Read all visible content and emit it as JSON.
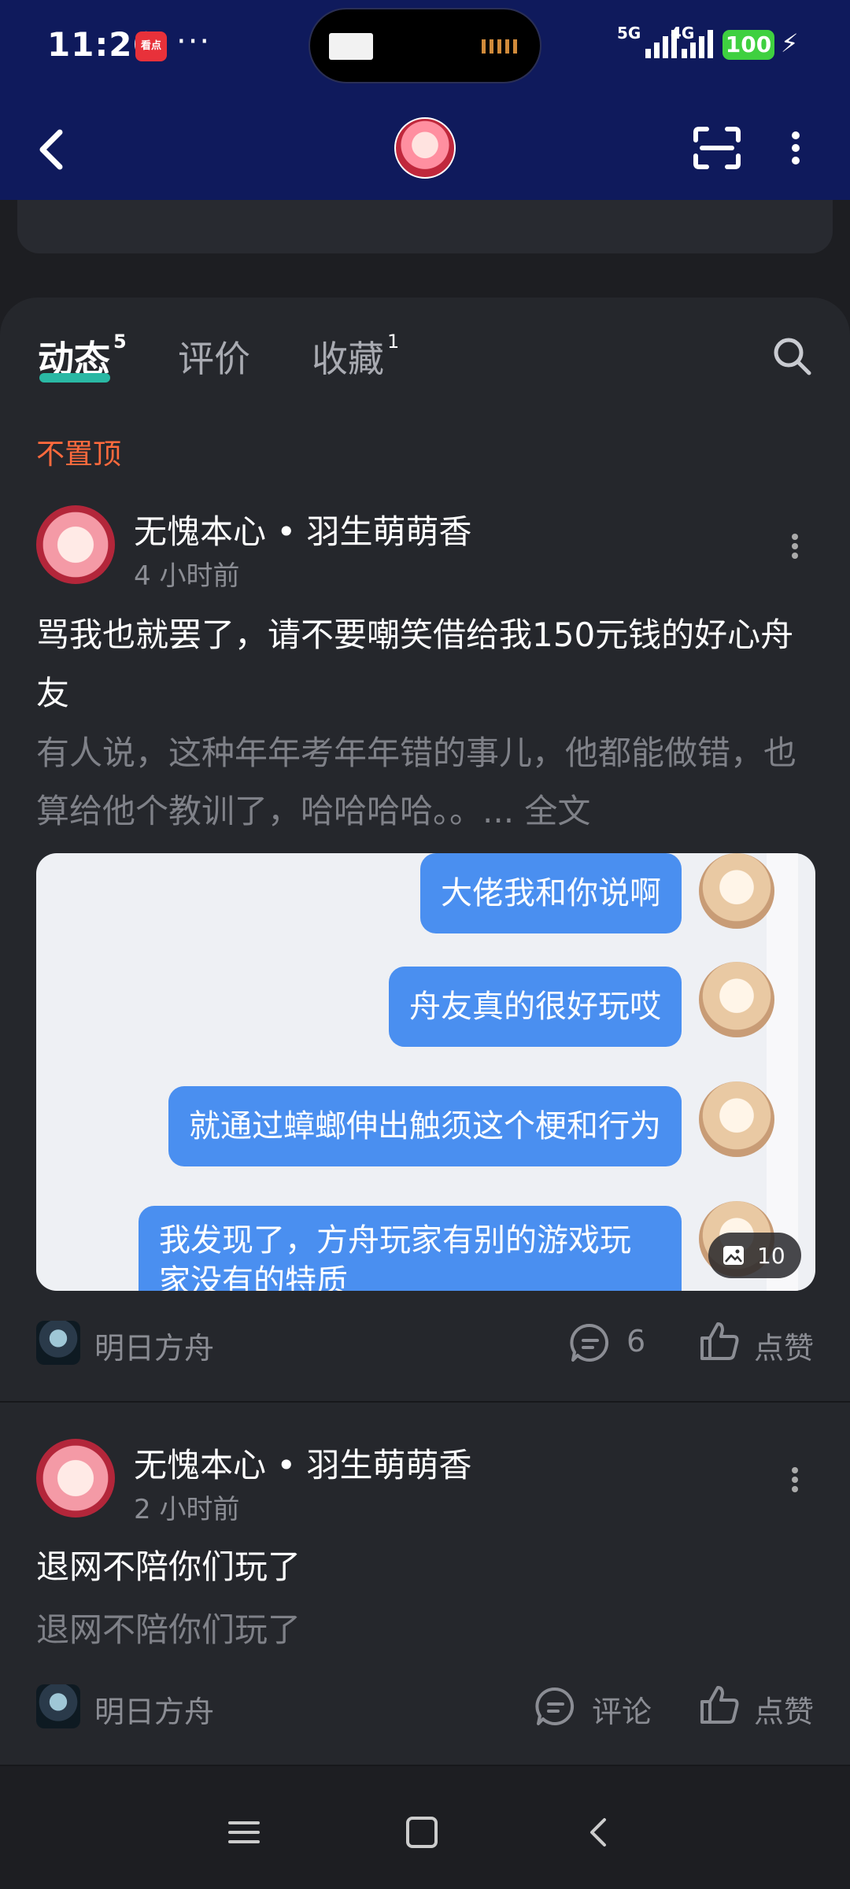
{
  "status_bar": {
    "time": "11:26",
    "app_badge": "看点",
    "dots": "···",
    "net1": "5G",
    "net2": "4G",
    "battery": "100"
  },
  "tabs": [
    {
      "label": "动态",
      "count": "5"
    },
    {
      "label": "评价",
      "count": ""
    },
    {
      "label": "收藏",
      "count": "1"
    }
  ],
  "pin_label": "不置顶",
  "posts": [
    {
      "author": "无愧本心 • 羽生萌萌香",
      "time": "4 小时前",
      "title": "骂我也就罢了，请不要嘲笑借给我150元钱的好心舟友",
      "body": "有人说，这种年年考年年错的事儿，他都能做错，也算给他个教训了，哈哈哈哈。。...",
      "more_link": "全文",
      "image_bubbles": [
        "大佬我和你说啊",
        "舟友真的很好玩哎",
        "就通过蟑螂伸出触须这个梗和行为",
        "我发现了，方舟玩家有别的游戏玩家没有的特质"
      ],
      "image_count": "10",
      "game": "明日方舟",
      "comments": "6",
      "like_label": "点赞"
    },
    {
      "author": "无愧本心 • 羽生萌萌香",
      "time": "2 小时前",
      "title": "退网不陪你们玩了",
      "body": "退网不陪你们玩了",
      "game": "明日方舟",
      "comment_label": "评论",
      "like_label": "点赞"
    }
  ],
  "colors": {
    "header_bg": "#0f1a5c",
    "panel_bg": "#25272c",
    "accent_tab": "#2ab8a4",
    "pin_orange": "#ff6a3d",
    "bubble_blue": "#4a8ff0"
  }
}
